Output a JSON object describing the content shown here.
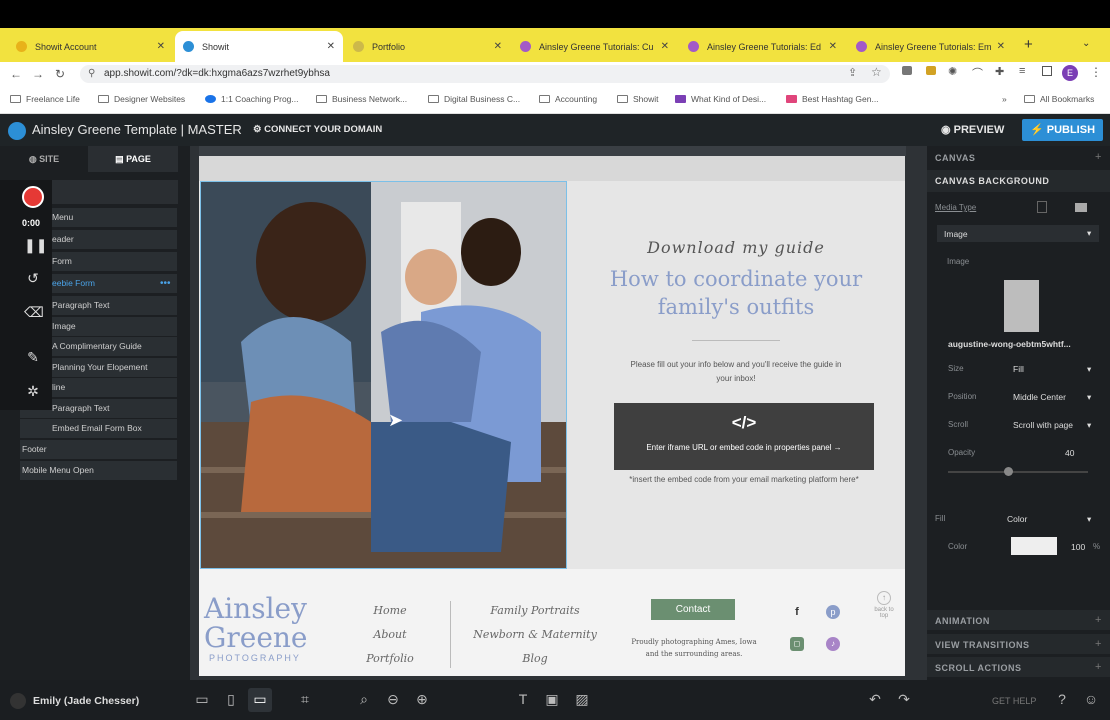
{
  "browser": {
    "tabs": [
      {
        "label": "Showit Account",
        "favicon": "#e8b21a"
      },
      {
        "label": "Showit",
        "favicon": "#2c8fd6"
      },
      {
        "label": "Portfolio",
        "favicon": "#cdb94a"
      },
      {
        "label": "Ainsley Greene Tutorials: Cu",
        "favicon": "#a35ac7"
      },
      {
        "label": "Ainsley Greene Tutorials: Ed",
        "favicon": "#a35ac7"
      },
      {
        "label": "Ainsley Greene Tutorials: Em",
        "favicon": "#a35ac7"
      }
    ],
    "url": "app.showit.com/?dk=dk:hxgma6azs7wzrhet9ybhsa",
    "profile_initial": "E",
    "bookmarks": [
      "Freelance Life",
      "Designer Websites",
      "1:1 Coaching Prog...",
      "Business Network...",
      "Digital Business C...",
      "Accounting",
      "Showit",
      "What Kind of Desi...",
      "Best Hashtag Gen..."
    ],
    "all_bookmarks": "All Bookmarks"
  },
  "app": {
    "title": "Ainsley Greene Template | MASTER",
    "connect_domain": "CONNECT YOUR DOMAIN",
    "preview": "PREVIEW",
    "publish": "PUBLISH"
  },
  "left_panel": {
    "tab_site": "SITE",
    "tab_page": "PAGE",
    "recorder_time": "0:00",
    "layers": [
      "Menu",
      "eader",
      "Form",
      "eebie Form",
      "Paragraph Text",
      "Image",
      "A Complimentary Guide",
      "Planning Your Elopement",
      "line",
      "Paragraph Text",
      "Embed Email Form Box",
      "Footer",
      "Mobile Menu Open"
    ]
  },
  "canvas": {
    "download_guide": "Download my guide",
    "headline": "How to coordinate your family's outfits",
    "fill_out": "Please fill out your info below and you'll receive the guide in your inbox!",
    "embed_icon": "</>",
    "embed_text": "Enter iframe URL or embed code in properties panel →",
    "insert_note": "*insert the embed code from your email marketing platform here*",
    "footer": {
      "brand_line1": "Ainsley",
      "brand_line2": "Greene",
      "brand_line3": "PHOTOGRAPHY",
      "nav_left": [
        "Home",
        "About",
        "Portfolio"
      ],
      "nav_right": [
        "Family Portraits",
        "Newborn & Maternity",
        "Blog"
      ],
      "contact": "Contact",
      "proudly": "Proudly photographing Ames, Iowa and the surrounding areas.",
      "back_to_top": "back to top"
    }
  },
  "right_panel": {
    "canvas": "CANVAS",
    "canvas_background": "CANVAS BACKGROUND",
    "media_type": "Media Type",
    "media_value": "Image",
    "image_label": "Image",
    "image_name": "augustine-wong-oebtm5whtf...",
    "size_label": "Size",
    "size_value": "Fill",
    "position_label": "Position",
    "position_value": "Middle Center",
    "scroll_label": "Scroll",
    "scroll_value": "Scroll with page",
    "opacity_label": "Opacity",
    "opacity_value": "40",
    "fill_label": "Fill",
    "fill_value": "Color",
    "color_label": "Color",
    "color_value": "100",
    "color_unit": "%",
    "animation": "ANIMATION",
    "view_transitions": "VIEW TRANSITIONS",
    "scroll_actions": "SCROLL ACTIONS"
  },
  "bottom": {
    "user": "Emily (Jade Chesser)",
    "get_help": "GET HELP"
  },
  "colors": {
    "accent": "#2c8fd6",
    "brand_blue": "#8a9dc9",
    "contact_green": "#6b8f71",
    "record_red": "#e53935"
  }
}
